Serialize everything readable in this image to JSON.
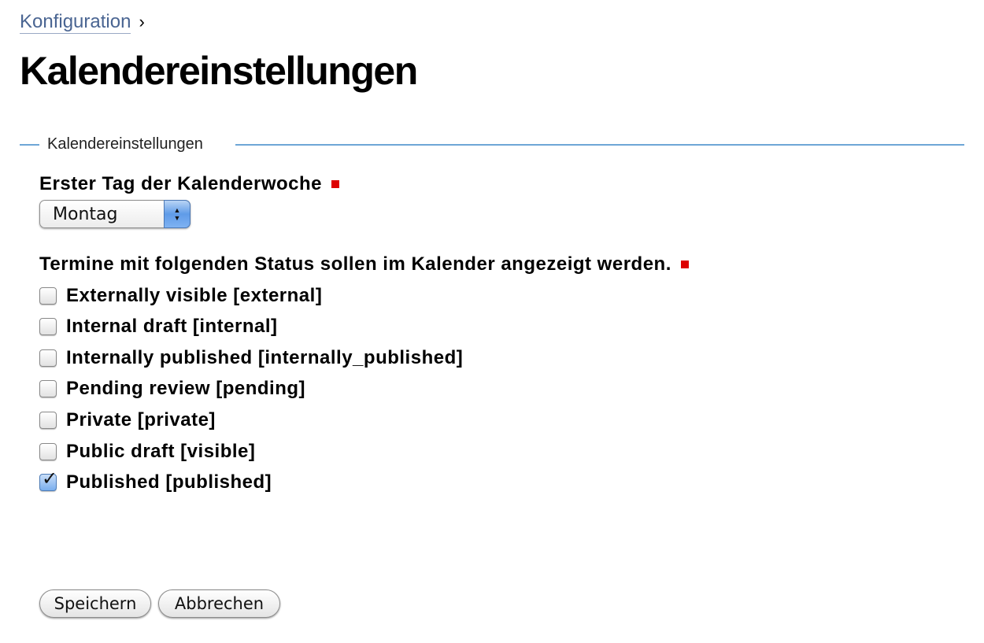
{
  "breadcrumb": {
    "link_label": "Konfiguration",
    "separator": "›"
  },
  "page": {
    "title": "Kalendereinstellungen"
  },
  "fieldset": {
    "legend": "Kalendereinstellungen"
  },
  "first_day": {
    "label": "Erster Tag der Kalenderwoche",
    "required": true,
    "selected_value": "Montag"
  },
  "status": {
    "label": "Termine mit folgenden Status sollen im Kalender angezeigt werden.",
    "required": true,
    "options": [
      {
        "label": "Externally visible [external]",
        "checked": false
      },
      {
        "label": "Internal draft [internal]",
        "checked": false
      },
      {
        "label": "Internally published [internally_published]",
        "checked": false
      },
      {
        "label": "Pending review [pending]",
        "checked": false
      },
      {
        "label": "Private [private]",
        "checked": false
      },
      {
        "label": "Public draft [visible]",
        "checked": false
      },
      {
        "label": "Published [published]",
        "checked": true
      }
    ]
  },
  "buttons": {
    "save_label": "Speichern",
    "cancel_label": "Abbrechen"
  },
  "colors": {
    "link": "#4a6592",
    "fieldset_line": "#6ea6d6",
    "required_marker": "#dd0000",
    "select_stepper": "#5f9be8"
  },
  "icons": {
    "required": "required-marker-icon",
    "stepper": "up-down-arrows-icon",
    "check": "checkmark-icon"
  }
}
